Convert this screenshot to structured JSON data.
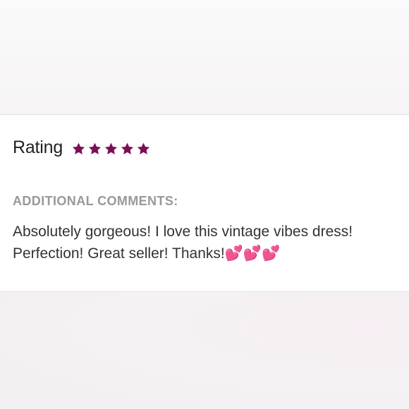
{
  "review": {
    "rating_label": "Rating",
    "rating_value": 5,
    "rating_max": 5,
    "star_color": "#7b0f57",
    "star_icon": "star-icon",
    "comments_heading": "ADDITIONAL COMMENTS:",
    "comment_text": "Absolutely gorgeous! I love this vintage vibes dress! Perfection! Great seller! Thanks!💕💕💕"
  }
}
